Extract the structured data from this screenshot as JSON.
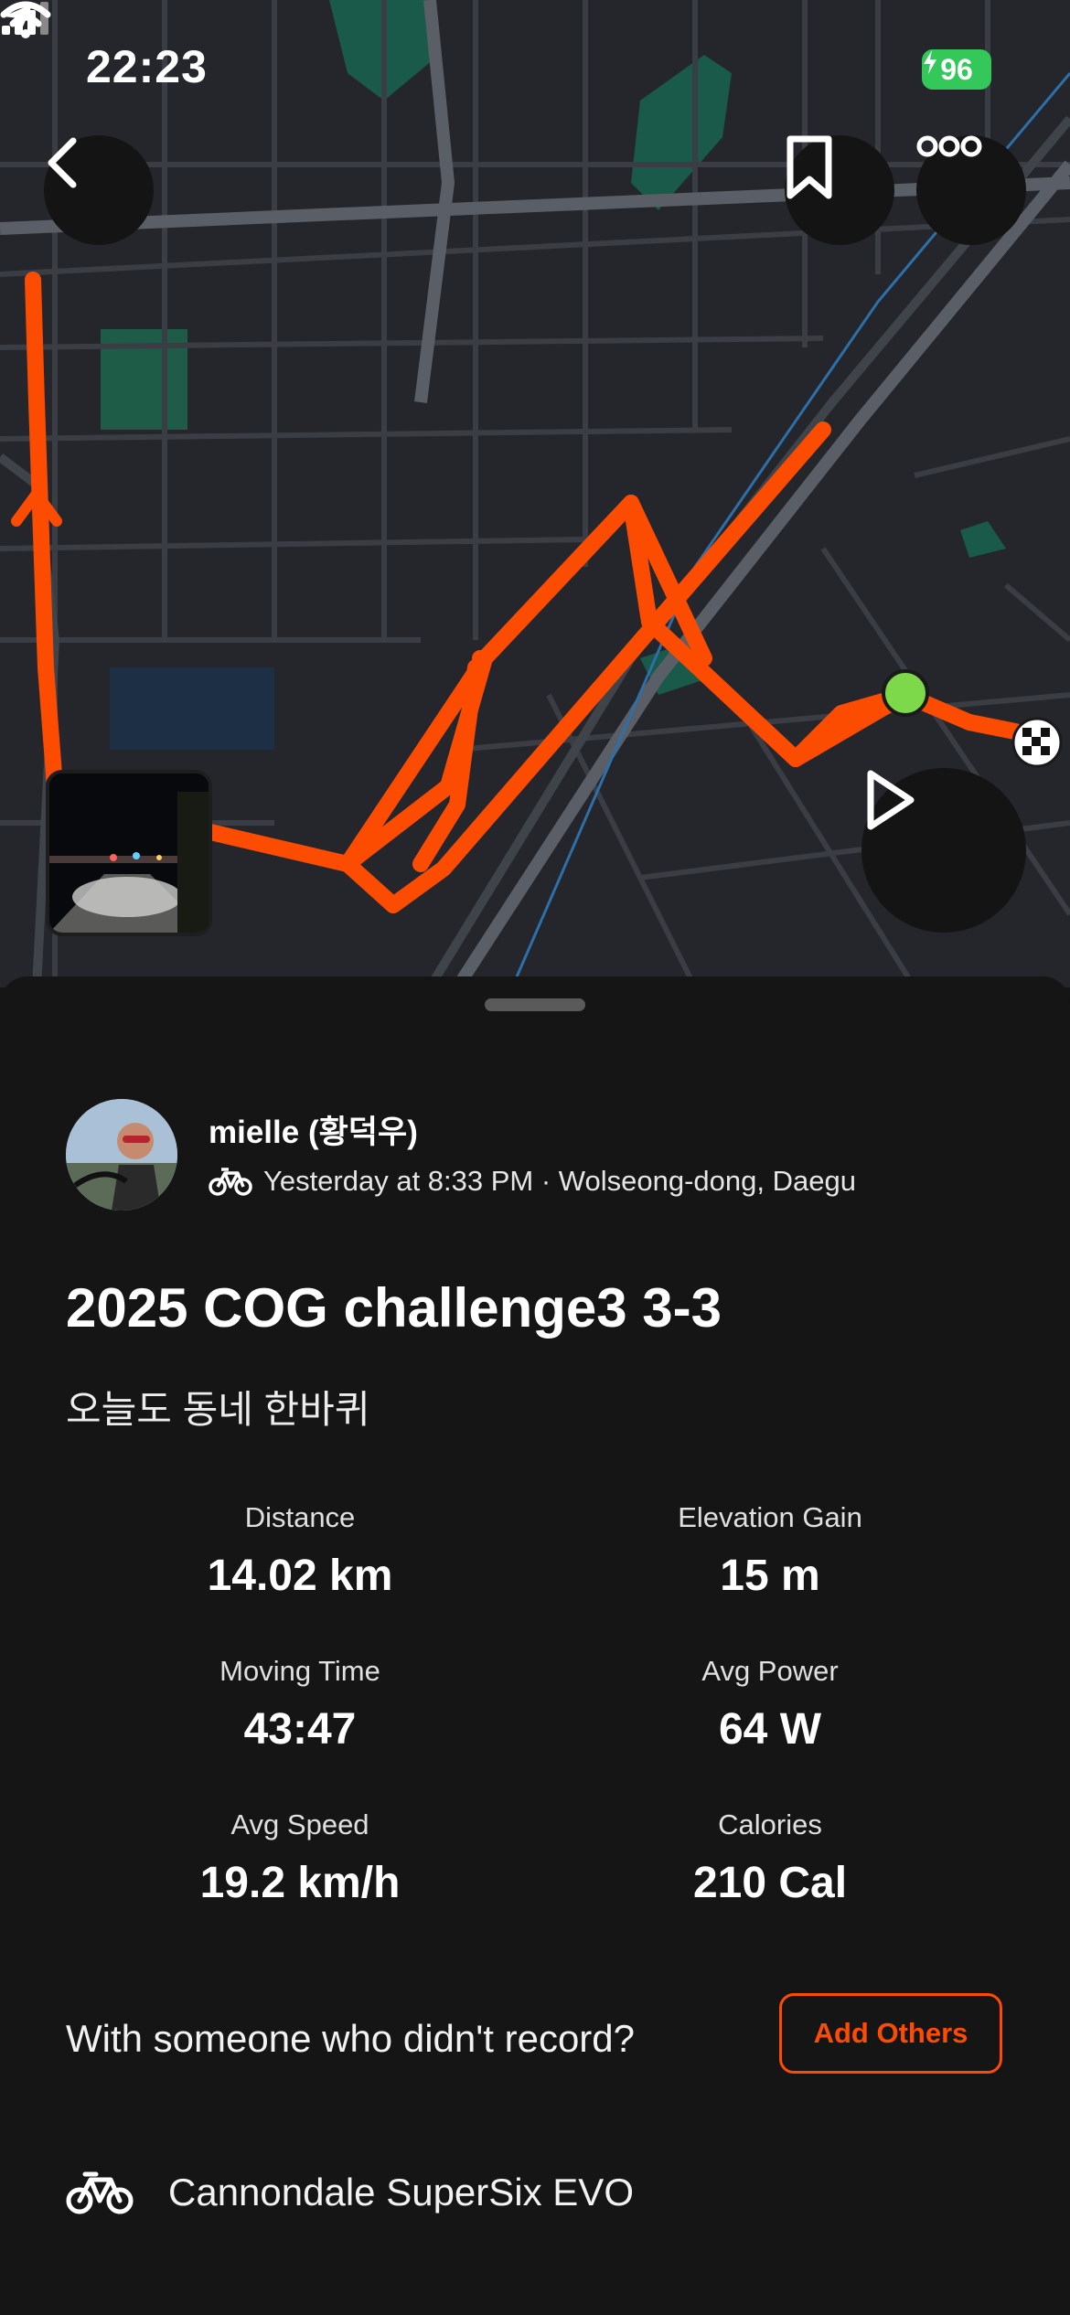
{
  "status": {
    "time": "22:23",
    "battery": "96"
  },
  "map": {
    "route_color": "#fc4c02",
    "start_marker_color": "#7dd94a",
    "water_color": "#1a5a4a",
    "icons": [
      "back-chevron-icon",
      "bookmark-icon",
      "more-dots-icon",
      "play-icon"
    ]
  },
  "activity": {
    "user_name": "mielle (황덕우)",
    "meta": "Yesterday at 8:33 PM · Wolseong-dong, Daegu",
    "title": "2025 COG challenge3 3-3",
    "description": "오늘도 동네 한바퀴"
  },
  "stats": {
    "distance": {
      "label": "Distance",
      "value": "14.02 km"
    },
    "elevation": {
      "label": "Elevation Gain",
      "value": "15 m"
    },
    "moving_time": {
      "label": "Moving Time",
      "value": "43:47"
    },
    "avg_power": {
      "label": "Avg Power",
      "value": "64 W"
    },
    "avg_speed": {
      "label": "Avg Speed",
      "value": "19.2 km/h"
    },
    "calories": {
      "label": "Calories",
      "value": "210 Cal"
    }
  },
  "with_others": {
    "prompt": "With someone who didn't record?",
    "button": "Add Others"
  },
  "gear": {
    "bike": "Cannondale SuperSix EVO"
  }
}
